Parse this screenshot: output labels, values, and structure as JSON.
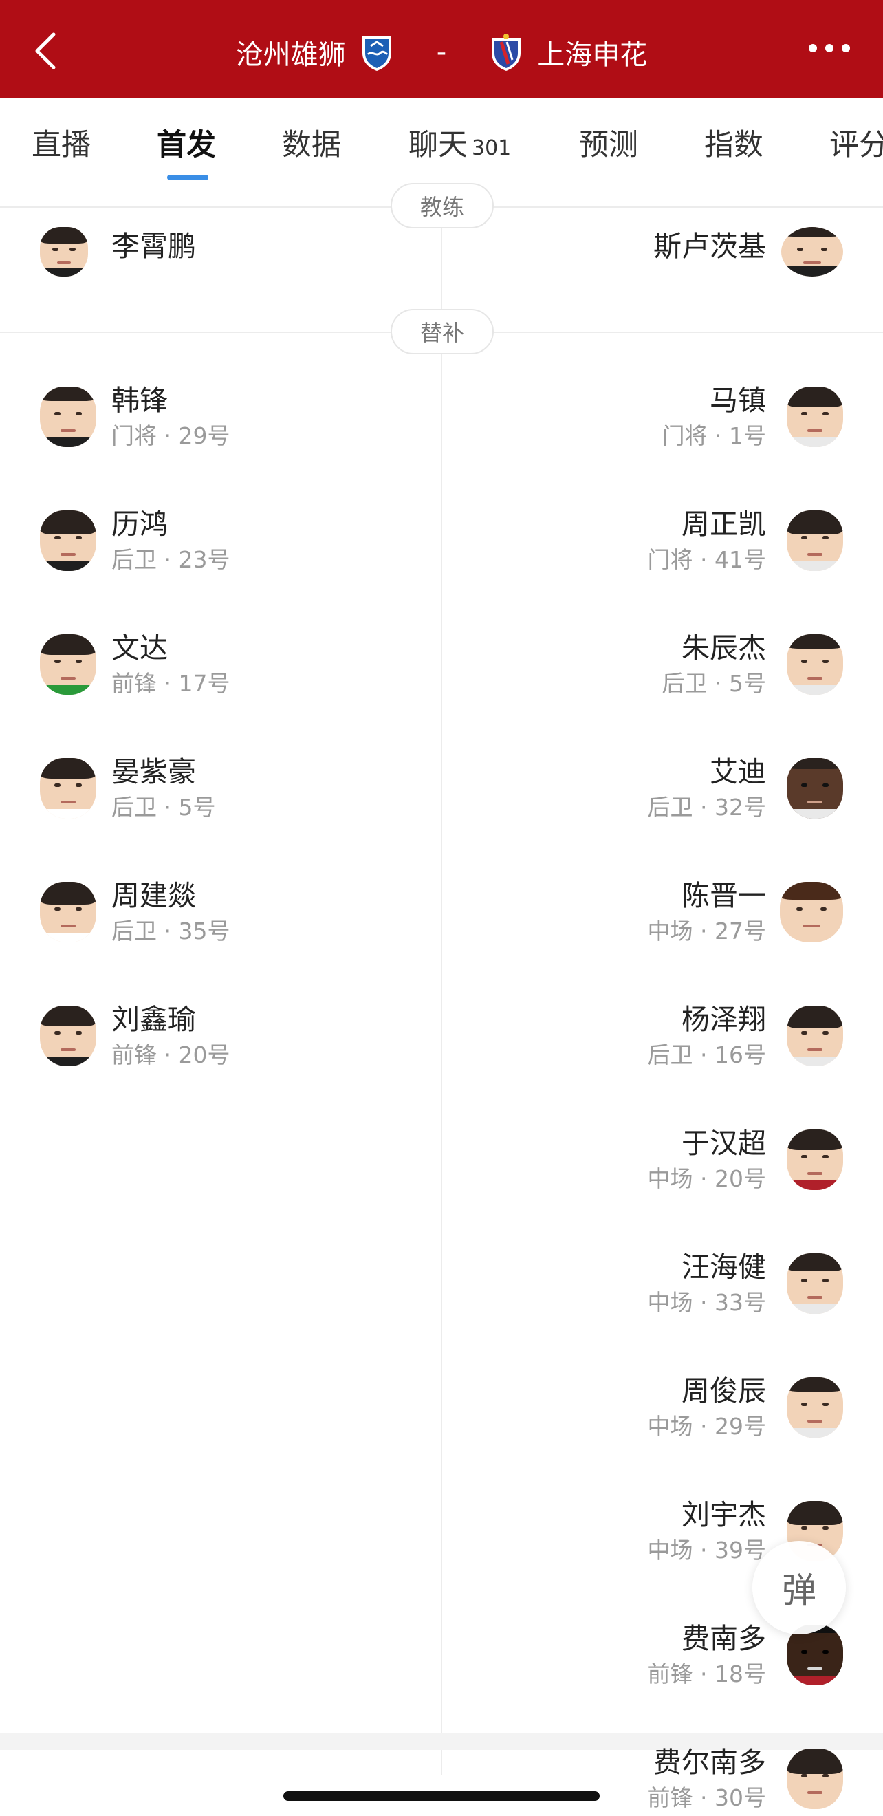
{
  "header": {
    "home_team": "沧州雄狮",
    "separator": "-",
    "away_team": "上海申花",
    "back_icon": "chevron-left-icon",
    "more_icon": "more-dots-icon",
    "bg_color": "#b00d15"
  },
  "tabs": [
    {
      "label": "直播"
    },
    {
      "label": "首发",
      "active": true
    },
    {
      "label": "数据"
    },
    {
      "label": "聊天",
      "badge": "301"
    },
    {
      "label": "预测"
    },
    {
      "label": "指数"
    },
    {
      "label": "评分"
    }
  ],
  "sections": {
    "coach_label": "教练",
    "subs_label": "替补"
  },
  "coaches": {
    "home": "李霄鹏",
    "away": "斯卢茨基"
  },
  "home_subs": [
    {
      "name": "韩锋",
      "info": "门将 · 29号"
    },
    {
      "name": "历鸿",
      "info": "后卫 · 23号"
    },
    {
      "name": "文达",
      "info": "前锋 · 17号"
    },
    {
      "name": "晏紫豪",
      "info": "后卫 · 5号"
    },
    {
      "name": "周建燚",
      "info": "后卫 · 35号"
    },
    {
      "name": "刘鑫瑜",
      "info": "前锋 · 20号"
    }
  ],
  "away_subs": [
    {
      "name": "马镇",
      "info": "门将 · 1号"
    },
    {
      "name": "周正凯",
      "info": "门将 · 41号"
    },
    {
      "name": "朱辰杰",
      "info": "后卫 · 5号"
    },
    {
      "name": "艾迪",
      "info": "后卫 · 32号"
    },
    {
      "name": "陈晋一",
      "info": "中场 · 27号"
    },
    {
      "name": "杨泽翔",
      "info": "后卫 · 16号"
    },
    {
      "name": "于汉超",
      "info": "中场 · 20号"
    },
    {
      "name": "汪海健",
      "info": "中场 · 33号"
    },
    {
      "name": "周俊辰",
      "info": "中场 · 29号"
    },
    {
      "name": "刘宇杰",
      "info": "中场 · 39号"
    },
    {
      "name": "费南多",
      "info": "前锋 · 18号"
    },
    {
      "name": "费尔南多",
      "info": "前锋 · 30号"
    }
  ],
  "danmu_label": "弹",
  "accent_color": "#3a8ee6"
}
